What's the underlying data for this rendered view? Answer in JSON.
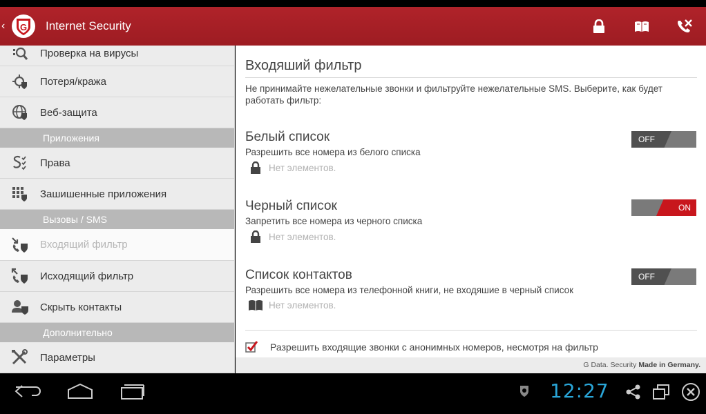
{
  "app": {
    "title": "Internet Security"
  },
  "sidebar": {
    "items": [
      {
        "label": "Проверка на вирусы",
        "icon": "virus-scan-icon"
      },
      {
        "label": "Потеря/кража",
        "icon": "location-target-icon"
      },
      {
        "label": "Веб-защита",
        "icon": "globe-icon"
      },
      {
        "label": "Права",
        "icon": "permissions-icon"
      },
      {
        "label": "Зашишенные приложения",
        "icon": "protected-apps-icon"
      },
      {
        "label": "Входящий фильтр",
        "icon": "incoming-filter-icon",
        "active": true
      },
      {
        "label": "Исходящий фильтр",
        "icon": "outgoing-filter-icon"
      },
      {
        "label": "Скрыть контакты",
        "icon": "hide-contacts-icon"
      },
      {
        "label": "Параметры",
        "icon": "tools-icon"
      }
    ],
    "sections": [
      "Приложения",
      "Вызовы / SMS",
      "Дополнительно"
    ]
  },
  "content": {
    "title": "Входяший фильтр",
    "description": "Не принимайте нежелательные звонки и фильтруйте нежелательные SMS. Выберите, как будет работать фильтр:",
    "lists": [
      {
        "title": "Белый список",
        "description": "Разрешить все номера из белого списка",
        "empty": "Нет элементов.",
        "toggle": "OFF",
        "icon": "lock-icon"
      },
      {
        "title": "Черный список",
        "description": "Запретить все номера из черного списка",
        "empty": "Нет элементов.",
        "toggle": "ON",
        "icon": "lock-icon"
      },
      {
        "title": "Список контактов",
        "description": "Разрешить все номера из телефонной книги, не входяшие в черный список",
        "empty": "Нет элементов.",
        "toggle": "OFF",
        "icon": "book-icon"
      }
    ],
    "anonymous_option": "Разрешить входящие звонки с анонимных номеров, несмотря на фильтр",
    "footer": {
      "brand": "G Data. Security",
      "slogan": "Made in Germany."
    }
  },
  "system_bar": {
    "clock": "12:27"
  },
  "colors": {
    "brand_red": "#b0232a",
    "toggle_on": "#c8161d",
    "clock": "#2aa6d8"
  }
}
